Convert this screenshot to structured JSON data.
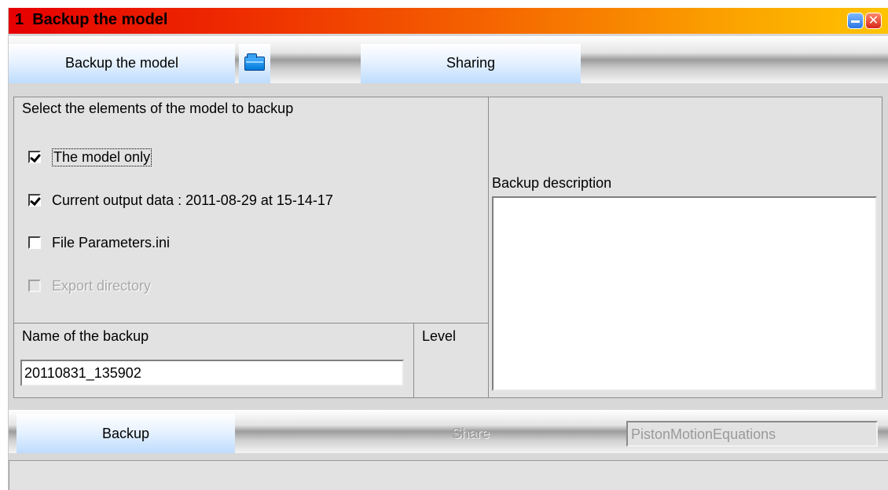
{
  "window": {
    "title": "1  Backup the model",
    "minimize_icon": "minimize-icon",
    "close_icon": "close-icon",
    "close_glyph": "✕"
  },
  "toolbar": {
    "backup_tab": "Backup the model",
    "folder_icon": "folder-icon",
    "sharing_tab": "Sharing"
  },
  "select_panel": {
    "heading": "Select the elements of the model to backup",
    "options": [
      {
        "label": "The model only",
        "checked": true,
        "enabled": true,
        "focused": true
      },
      {
        "label": "Current output data : 2011-08-29 at 15-14-17",
        "checked": true,
        "enabled": true
      },
      {
        "label": "File Parameters.ini",
        "checked": false,
        "enabled": true
      },
      {
        "label": "Export directory",
        "checked": false,
        "enabled": false
      }
    ]
  },
  "name_panel": {
    "label": "Name of the backup",
    "value": "20110831_135902"
  },
  "level_panel": {
    "label": "Level"
  },
  "description_panel": {
    "label": "Backup description",
    "value": ""
  },
  "bottom": {
    "backup_button": "Backup",
    "share_button": "Share",
    "model_name": "PistonMotionEquations"
  },
  "status": {
    "text": ""
  }
}
